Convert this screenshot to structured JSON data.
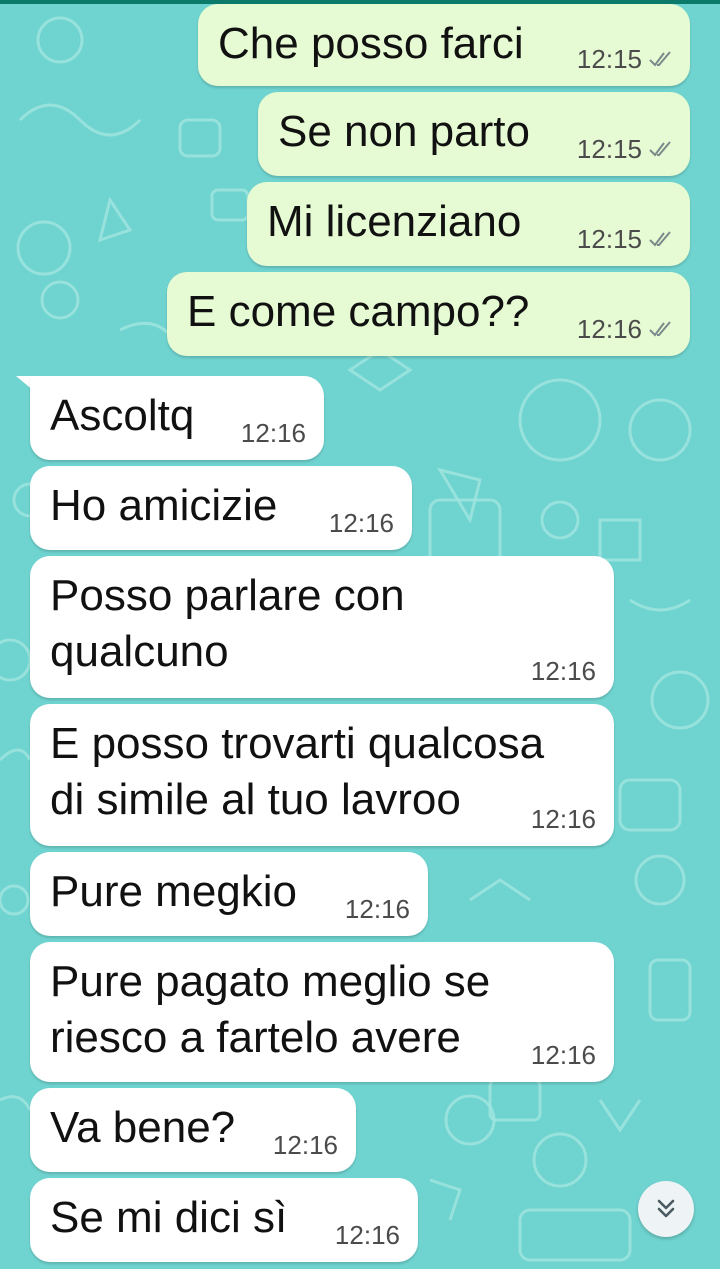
{
  "messages": [
    {
      "direction": "out",
      "text": "Che posso farci",
      "time": "12:15"
    },
    {
      "direction": "out",
      "text": "Se non parto",
      "time": "12:15"
    },
    {
      "direction": "out",
      "text": "Mi licenziano",
      "time": "12:15"
    },
    {
      "direction": "out",
      "text": "E come campo??",
      "time": "12:16"
    },
    {
      "direction": "in",
      "text": "Ascoltq",
      "time": "12:16"
    },
    {
      "direction": "in",
      "text": "Ho amicizie",
      "time": "12:16"
    },
    {
      "direction": "in",
      "text": "Posso parlare con\nqualcuno",
      "time": "12:16"
    },
    {
      "direction": "in",
      "text": "E posso trovarti qualcosa\ndi simile al tuo lavroo",
      "time": "12:16"
    },
    {
      "direction": "in",
      "text": "Pure megkio",
      "time": "12:16"
    },
    {
      "direction": "in",
      "text": "Pure pagato meglio se\nriesco a fartelo avere",
      "time": "12:16"
    },
    {
      "direction": "in",
      "text": "Va bene?",
      "time": "12:16"
    },
    {
      "direction": "in",
      "text": "Se mi dici sì",
      "time": "12:16"
    }
  ],
  "colors": {
    "wallpaper": "#6fd3cf",
    "outgoing_bubble": "#e6fbd3",
    "incoming_bubble": "#ffffff",
    "read_ticks": "#7a8a8a"
  },
  "icons": {
    "read_receipt": "double-check-icon",
    "scroll_down": "chevron-double-down-icon"
  }
}
